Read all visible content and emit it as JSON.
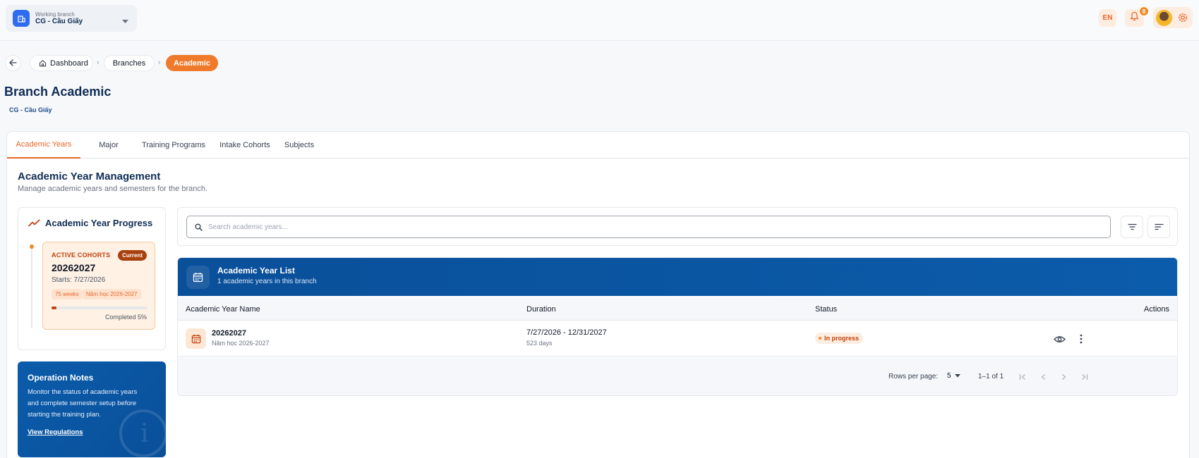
{
  "topbar": {
    "branch_caption": "Working branch",
    "branch_name": "CG - Cầu Giấy",
    "language": "EN",
    "notification_count": "8"
  },
  "breadcrumb": {
    "items": [
      "Dashboard",
      "Branches",
      "Academic"
    ],
    "separator": "›"
  },
  "page": {
    "title": "Branch Academic",
    "subtitle": "CG - Cầu Giấy"
  },
  "tabs": [
    {
      "label": "Academic Years",
      "active": true
    },
    {
      "label": "Major",
      "active": false
    },
    {
      "label": "Training Programs",
      "active": false
    },
    {
      "label": "Intake Cohorts",
      "active": false
    },
    {
      "label": "Subjects",
      "active": false
    }
  ],
  "section": {
    "title": "Academic Year Management",
    "subtitle": "Manage academic years and semesters for the branch."
  },
  "progress": {
    "title": "Academic Year Progress",
    "cohort_label": "ACTIVE COHORTS",
    "badge": "Current",
    "year": "20262027",
    "starts": "Starts: 7/27/2026",
    "chips": [
      "75 weeks",
      "Năm học 2026-2027"
    ],
    "completed_percent": 5,
    "completed_label": "Completed 5%"
  },
  "notes": {
    "title": "Operation Notes",
    "body": "Monitor the status of academic years and complete semester setup before starting the training plan.",
    "link": "View Regulations"
  },
  "search": {
    "placeholder": "Search academic years..."
  },
  "table": {
    "title": "Academic Year List",
    "subtitle": "1 academic years in this branch",
    "columns": [
      "Academic Year Name",
      "Duration",
      "Status",
      "Actions"
    ],
    "rows": [
      {
        "name": "20262027",
        "name_sub": "Năm học 2026-2027",
        "duration": "7/27/2026 - 12/31/2027",
        "days": "523 days",
        "status": "In progress"
      }
    ],
    "pagination": {
      "rows_label": "Rows per page:",
      "rows_value": "5",
      "range": "1–1 of 1"
    }
  },
  "colors": {
    "accent": "#e8662a",
    "brand": "#0a4f99",
    "title": "#0f2d54"
  }
}
